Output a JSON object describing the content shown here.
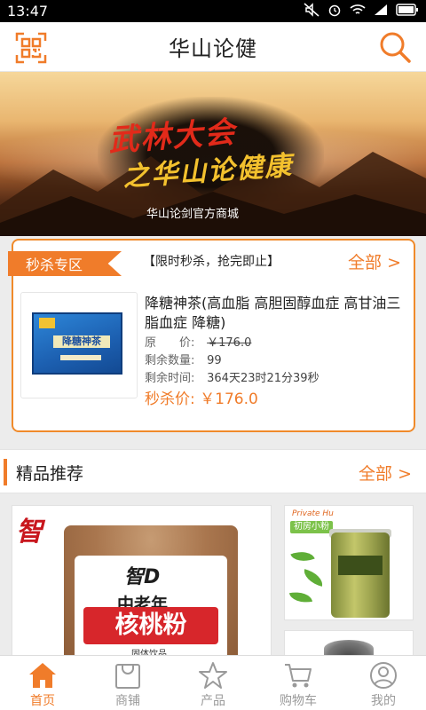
{
  "status_bar": {
    "time": "13:47",
    "icons": [
      "mute-icon",
      "alarm-icon",
      "wifi-icon",
      "signal-icon",
      "battery-icon"
    ]
  },
  "header": {
    "title": "华山论健",
    "left_icon": "qr-scan-icon",
    "right_icon": "search-icon"
  },
  "banner": {
    "line1": "武林大会",
    "line2": "之华山论健康",
    "subtitle": "华山论剑官方商城"
  },
  "flash_sale": {
    "badge": "秒杀专区",
    "notice": "【限时秒杀，抢完即止】",
    "all_link": "全部 >",
    "product": {
      "name": "降糖神茶(高血脂 高胆固醇血症 高甘油三脂血症 降糖)",
      "box_label": "降糖神茶",
      "original_price_label": "原　　价:",
      "original_price": "￥176.0",
      "remaining_qty_label": "剩余数量:",
      "remaining_qty": "99",
      "remaining_time_label": "剩余时间:",
      "remaining_time": "364天23时21分39秒",
      "sale_price_label": "秒杀价:",
      "sale_price": "￥176.0"
    }
  },
  "recommend": {
    "title": "精品推荐",
    "all_link": "全部 >",
    "items": [
      {
        "brand": "智",
        "bag_brand": "智D",
        "bag_line1": "中老年",
        "bag_line2": "核桃粉",
        "bag_line3": "固体饮品"
      },
      {
        "tag": "Private Hu",
        "subtag": "初房小粉"
      },
      {}
    ]
  },
  "bottom_nav": {
    "items": [
      {
        "label": "首页",
        "icon": "home-icon",
        "active": true
      },
      {
        "label": "商铺",
        "icon": "shop-bag-icon",
        "active": false
      },
      {
        "label": "产品",
        "icon": "star-icon",
        "active": false
      },
      {
        "label": "购物车",
        "icon": "cart-icon",
        "active": false
      },
      {
        "label": "我的",
        "icon": "user-icon",
        "active": false
      }
    ]
  },
  "colors": {
    "accent": "#f07c2a",
    "text": "#222222",
    "muted": "#9a9a9a"
  }
}
